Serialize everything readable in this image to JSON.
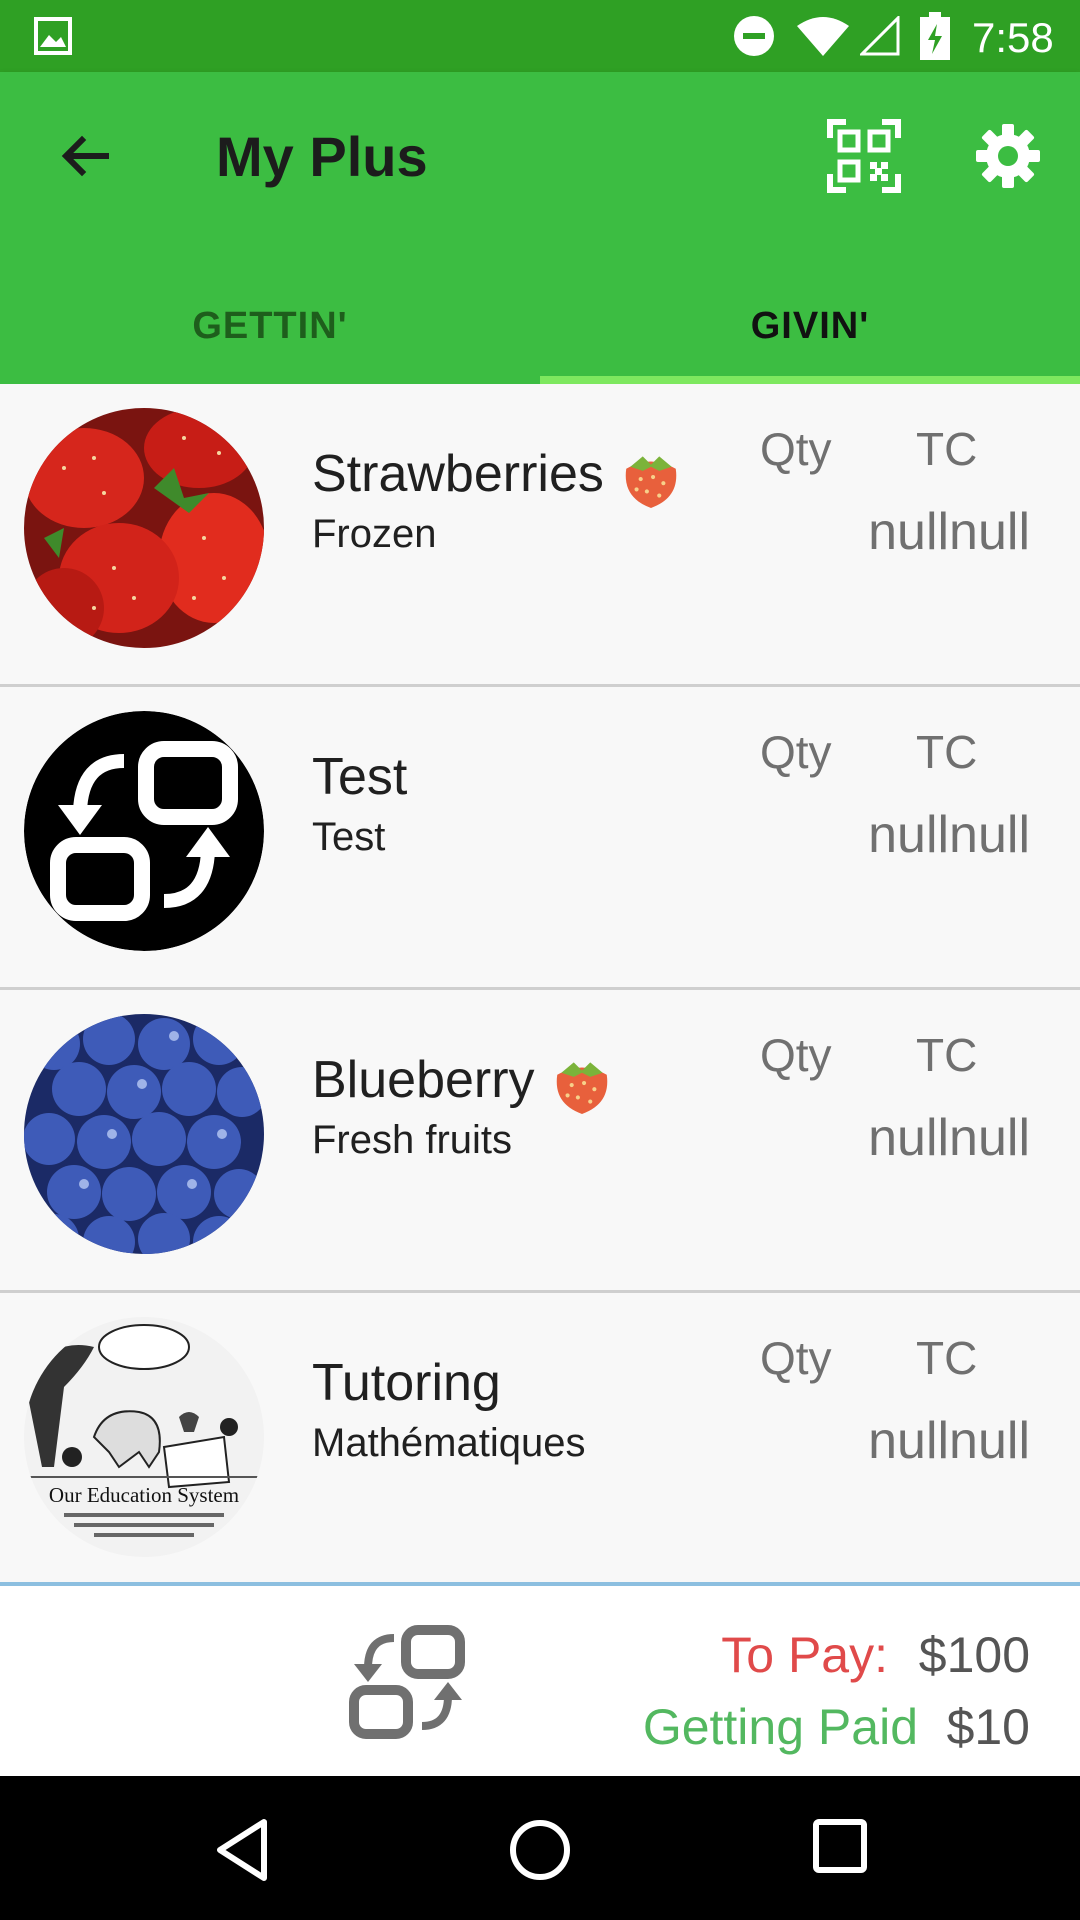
{
  "status_bar": {
    "time": "7:58"
  },
  "app_bar": {
    "title": "My Plus"
  },
  "tabs": [
    {
      "label": "GETTIN'",
      "selected": false
    },
    {
      "label": "GIVIN'",
      "selected": true
    }
  ],
  "items": [
    {
      "name": "Strawberries",
      "subtitle": "Frozen",
      "has_emoji": true,
      "emoji_icon": "strawberry-icon",
      "qty_label": "Qty",
      "tc_label": "TC",
      "value": "nullnull"
    },
    {
      "name": "Test",
      "subtitle": "Test",
      "has_emoji": false,
      "qty_label": "Qty",
      "tc_label": "TC",
      "value": "nullnull"
    },
    {
      "name": "Blueberry",
      "subtitle": "Fresh fruits",
      "has_emoji": true,
      "emoji_icon": "strawberry-icon",
      "qty_label": "Qty",
      "tc_label": "TC",
      "value": "nullnull"
    },
    {
      "name": "Tutoring",
      "subtitle": "Mathématiques",
      "has_emoji": false,
      "qty_label": "Qty",
      "tc_label": "TC",
      "value": "nullnull",
      "image_caption": "Our Education System"
    }
  ],
  "footer": {
    "to_pay_label": "To Pay:",
    "to_pay_value": "$100",
    "getting_paid_label": "Getting Paid",
    "getting_paid_value": "$10"
  },
  "colors": {
    "status_bar": "#2fa024",
    "app_bar": "#3cbd42",
    "tab_indicator": "#7ee85f",
    "to_pay": "#e04a4a",
    "getting_paid": "#53b860"
  }
}
